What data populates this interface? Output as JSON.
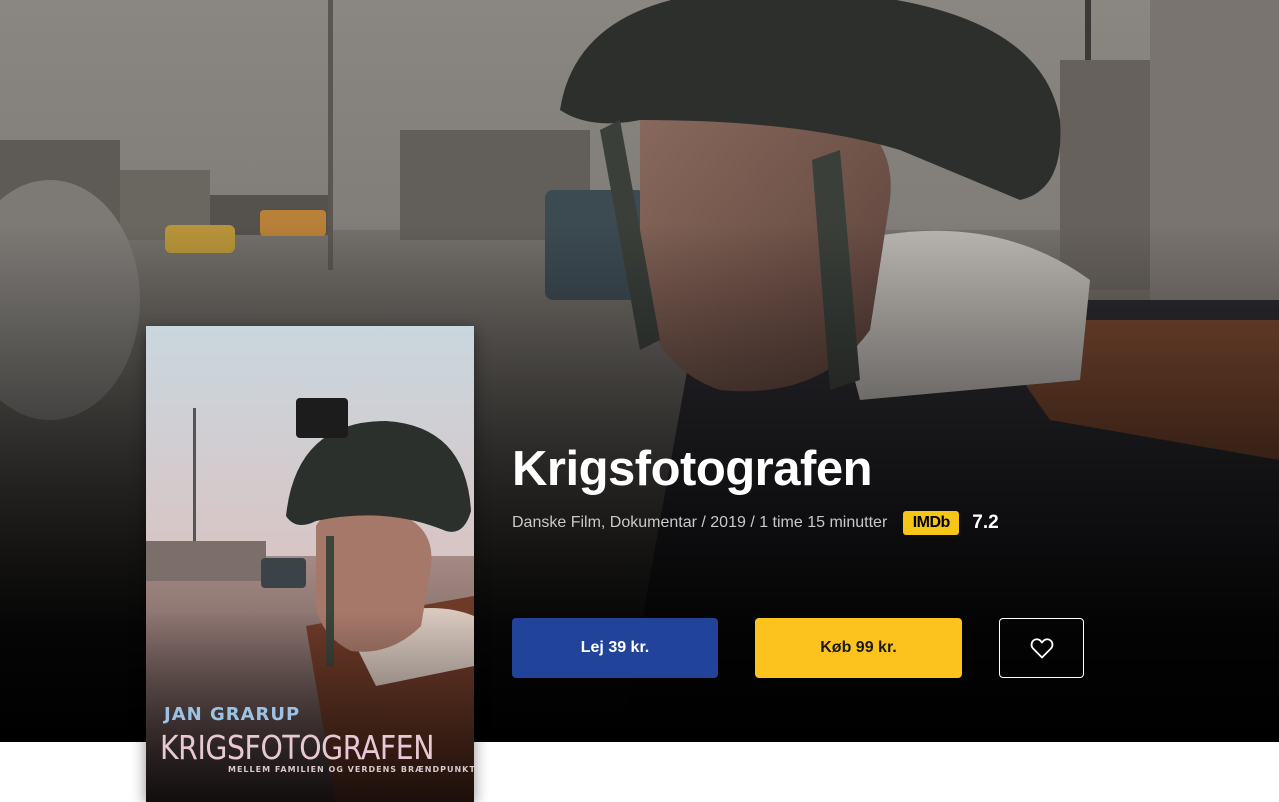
{
  "movie": {
    "title": "Krigsfotografen",
    "meta": "Danske Film, Dokumentar / 2019 / 1 time 15 minutter",
    "imdb": {
      "label": "IMDb",
      "score": "7.2",
      "color": "#f5c518"
    }
  },
  "poster": {
    "author": "JAN GRARUP",
    "title": "KRIGSFOTOGRAFEN",
    "tagline": "MELLEM FAMILIEN OG VERDENS BRÆNDPUNKTER"
  },
  "actions": {
    "rent_label": "Lej 39 kr.",
    "buy_label": "Køb 99 kr.",
    "favorite_icon": "heart-icon"
  },
  "colors": {
    "rent": "#21449a",
    "buy": "#fcc31e",
    "hero_bg": "#0c0c0c"
  }
}
